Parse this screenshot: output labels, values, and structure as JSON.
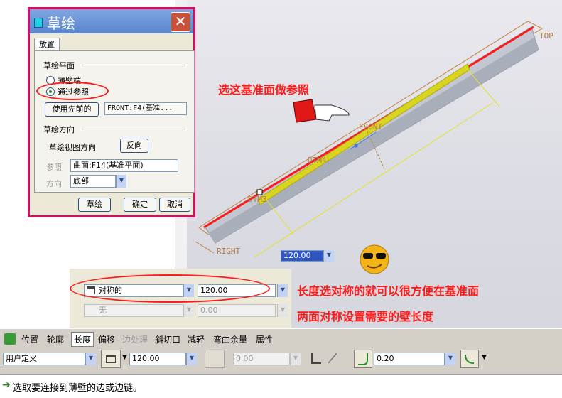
{
  "dialog": {
    "title": "草绘",
    "close_glyph": "✕",
    "tab_label": "放置",
    "plane_section": "草绘平面",
    "radio_thin_end": "薄壁端",
    "radio_through_ref": "通过参照",
    "use_prev_button": "使用先前的",
    "plane_value": "FRONT:F4(基准...",
    "direction_section": "草绘方向",
    "view_dir_label": "草绘视图方向",
    "flip_button": "反向",
    "reference_label": "参照",
    "reference_value": "曲面:F14(基准平面)",
    "orientation_label": "方向",
    "orientation_value": "底部",
    "sketch_button": "草绘",
    "ok_button": "确定",
    "cancel_button": "取消"
  },
  "viewport": {
    "label_top": "TOP",
    "label_front": "FRONT",
    "label_right": "RIGHT",
    "label_dtm4": "DTM4",
    "label_dtm3": "DTM3",
    "dim_value": "120.00"
  },
  "annotations": {
    "select_plane": "选这基准面做参照",
    "symmetric_line1": "长度选对称的就可以很方便在基准面",
    "symmetric_line2": "两面对称设置需要的壁长度"
  },
  "length_panel": {
    "side1_option": "对称的",
    "side1_value": "120.00",
    "side2_option": "无",
    "side2_value": "0.00"
  },
  "dashboard_tabs": [
    "位置",
    "轮廓",
    "长度",
    "偏移",
    "边处理",
    "斜切口",
    "减轻",
    "弯曲余量",
    "属性"
  ],
  "toolbar": {
    "width_type": "用户定义",
    "length_value": "120.00",
    "angle_value": "0.00",
    "radius_value": "0.20"
  },
  "status": {
    "message": "选取要连接到薄壁的边或边链。"
  },
  "colors": {
    "highlight_red": "#ff1a1a",
    "dialog_border": "#d01060",
    "dim_yellow": "#e8e020"
  }
}
